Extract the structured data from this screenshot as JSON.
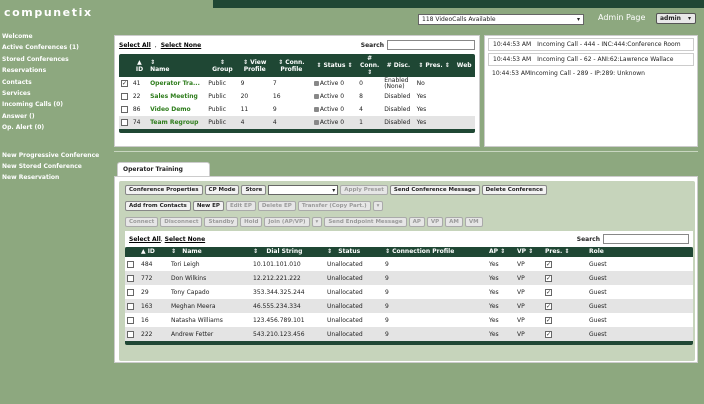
{
  "app": {
    "brand": "compunetix"
  },
  "header": {
    "vc_select": "118 VideoCalls Available",
    "admin_page_label": "Admin Page",
    "admin_user": "admin"
  },
  "sidebar": {
    "items": [
      "Welcome",
      "Active Conferences (1)",
      "Stored Conferences",
      "Reservations",
      "Contacts",
      "Services",
      "Incoming Calls (0)",
      "Answer ()",
      "Op. Alert (0)"
    ],
    "secondary": [
      "New Progressive Conference",
      "New Stored Conference",
      "New Reservation"
    ]
  },
  "conferences": {
    "select_all": "Select All",
    "select_none": "Select None",
    "search_label": "Search",
    "columns": [
      "ID",
      "Name",
      "Group",
      "View Profile",
      "Conn. Profile",
      "Status",
      "# Conn.",
      "# Disc.",
      "Pres.",
      "Web"
    ],
    "rows": [
      {
        "checked": true,
        "id": "41",
        "name": "Operator Tra...",
        "group": "Public",
        "view": "9",
        "conn_profile": "7",
        "status": "Active 0",
        "conn": "0",
        "disc": "Enabled (None)",
        "pres": "No",
        "web": ""
      },
      {
        "checked": false,
        "id": "22",
        "name": "Sales Meeting",
        "group": "Public",
        "view": "20",
        "conn_profile": "16",
        "status": "Active 0",
        "conn": "8",
        "disc": "Disabled",
        "pres": "Yes",
        "web": ""
      },
      {
        "checked": false,
        "id": "86",
        "name": "Video Demo",
        "group": "Public",
        "view": "11",
        "conn_profile": "9",
        "status": "Active 0",
        "conn": "4",
        "disc": "Disabled",
        "pres": "Yes",
        "web": ""
      },
      {
        "checked": false,
        "id": "74",
        "name": "Team Regroup",
        "group": "Public",
        "view": "4",
        "conn_profile": "4",
        "status": "Active 0",
        "conn": "1",
        "disc": "Disabled",
        "pres": "Yes",
        "web": ""
      }
    ]
  },
  "call_log": [
    {
      "time": "10:44:53 AM",
      "text": "Incoming Call - 444 - INC:444:Conference Room"
    },
    {
      "time": "10:44:53 AM",
      "text": "Incoming Call - 62 - ANI:62:Lawrence Wallace"
    },
    {
      "time": "10:44:53 AM",
      "text": "Incoming Call - 289 - IP:289: Unknown"
    }
  ],
  "operator": {
    "tab_label": "Operator Training",
    "close_glyph": "×",
    "row1": [
      "Conference Properties",
      "CP Mode",
      "Store"
    ],
    "apply_preset": "Apply Preset",
    "send_message": "Send Conference Message",
    "delete_conference": "Delete Conference",
    "row2": [
      "Add from Contacts",
      "New EP",
      "Edit EP",
      "Delete EP",
      "Transfer (Copy Part.)"
    ],
    "row3": [
      "Connect",
      "Disconnect",
      "Standby",
      "Hold",
      "Join (AP/VP)",
      "Send Endpoint Message",
      "AP",
      "VP",
      "AM",
      "VM"
    ],
    "select_all": "Select All",
    "select_none": "Select None",
    "search_label": "Search",
    "columns": [
      "ID",
      "Name",
      "Dial String",
      "Status",
      "Connection Profile",
      "AP",
      "VP",
      "Pres.",
      "Role"
    ],
    "rows": [
      {
        "id": "484",
        "name": "Tori Leigh",
        "dial": "10.101.101.010",
        "status": "Unallocated",
        "profile": "9",
        "ap": "Yes",
        "vp": "VP",
        "pres": "✓",
        "role": "Guest"
      },
      {
        "id": "772",
        "name": "Don Wilkins",
        "dial": "12.212.221.222",
        "status": "Unallocated",
        "profile": "9",
        "ap": "Yes",
        "vp": "VP",
        "pres": "✓",
        "role": "Guest"
      },
      {
        "id": "29",
        "name": "Tony Capado",
        "dial": "353.344.325.244",
        "status": "Unallocated",
        "profile": "9",
        "ap": "Yes",
        "vp": "VP",
        "pres": "✓",
        "role": "Guest"
      },
      {
        "id": "163",
        "name": "Meghan Meera",
        "dial": "46.555.234.334",
        "status": "Unallocated",
        "profile": "9",
        "ap": "Yes",
        "vp": "VP",
        "pres": "✓",
        "role": "Guest"
      },
      {
        "id": "16",
        "name": "Natasha Williams",
        "dial": "123.456.789.101",
        "status": "Unallocated",
        "profile": "9",
        "ap": "Yes",
        "vp": "VP",
        "pres": "✓",
        "role": "Guest"
      },
      {
        "id": "222",
        "name": "Andrew Fetter",
        "dial": "543.210.123.456",
        "status": "Unallocated",
        "profile": "9",
        "ap": "Yes",
        "vp": "VP",
        "pres": "✓",
        "role": "Guest"
      }
    ]
  },
  "colors": {
    "bg": "#8da87f",
    "dark": "#1f4734",
    "green_link": "#2e7d1c",
    "light": "#c6d4bb"
  }
}
